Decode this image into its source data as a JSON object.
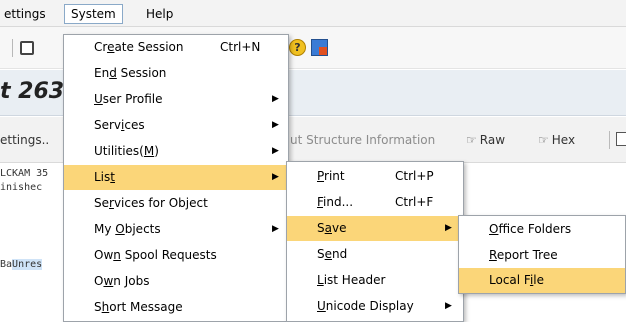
{
  "menubar": {
    "settings": "ettings",
    "system": "System",
    "help": "Help"
  },
  "toolbar": {
    "icons": [
      "print-icon",
      "help-icon",
      "layout-icon"
    ]
  },
  "title": "t 263",
  "apptoolbar": {
    "settings": "ettings..",
    "layout_info": "ut Structure Information",
    "raw": "Raw",
    "hex": "Hex"
  },
  "content": {
    "line1": "LCKAM 35",
    "line2": "inishec",
    "line3_a": "Ba",
    "line3_b": "Unres"
  },
  "system_menu": {
    "items": [
      {
        "label": "Create Session",
        "shortcut": "Ctrl+N"
      },
      {
        "label": "End Session"
      },
      {
        "label": "User Profile"
      },
      {
        "label": "Services"
      },
      {
        "label": "Utilities(M)"
      },
      {
        "label": "List"
      },
      {
        "label": "Services for Object"
      },
      {
        "label": "My Objects"
      },
      {
        "label": "Own Spool Requests"
      },
      {
        "label": "Own Jobs"
      },
      {
        "label": "Short Message"
      }
    ]
  },
  "list_menu": {
    "items": [
      {
        "label": "Print",
        "shortcut": "Ctrl+P"
      },
      {
        "label": "Find...",
        "shortcut": "Ctrl+F"
      },
      {
        "label": "Save"
      },
      {
        "label": "Send"
      },
      {
        "label": "List Header"
      },
      {
        "label": "Unicode Display"
      }
    ]
  },
  "save_menu": {
    "items": [
      {
        "label": "Office Folders"
      },
      {
        "label": "Report Tree"
      },
      {
        "label": "Local File"
      }
    ]
  },
  "colors": {
    "menu_highlight": "#fbd679",
    "menu_border": "#9da3aa",
    "title_bg": "#e9eef3"
  }
}
